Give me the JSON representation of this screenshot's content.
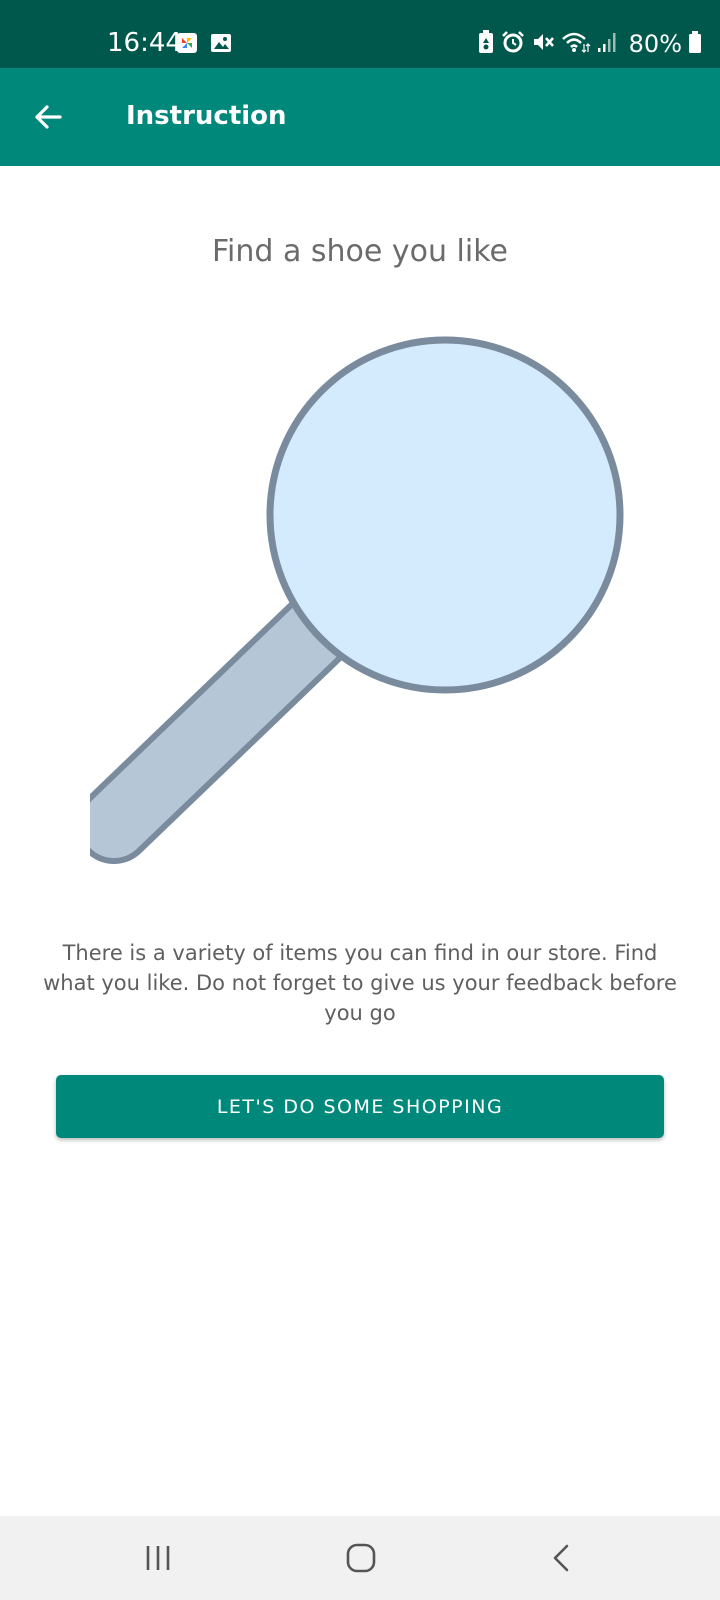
{
  "status_bar": {
    "time": "16:44",
    "battery": "80%",
    "left_icons": [
      "photos-app-icon",
      "gallery-icon"
    ],
    "right_icons": [
      "battery-saver-icon",
      "alarm-icon",
      "mute-icon",
      "wifi-icon",
      "signal-icon",
      "battery-icon"
    ]
  },
  "app_bar": {
    "title": "Instruction",
    "back_icon": "arrow-back-icon",
    "color": "#00897b"
  },
  "main": {
    "heading": "Find a shoe you like",
    "illustration": "magnifying-glass-icon",
    "description": "There is a variety of items you can find in our store. Find what you like. Do not forget to give us your feedback before you go",
    "button_label": "LET'S DO SOME SHOPPING"
  },
  "nav_bar": {
    "buttons": [
      "recent-apps-icon",
      "home-icon",
      "back-icon"
    ]
  },
  "colors": {
    "status_bar": "#00574b",
    "accent": "#00897b",
    "lens_fill": "#d3ebfc",
    "outline": "#7a8b9e",
    "handle_fill": "#b5c7d6"
  }
}
